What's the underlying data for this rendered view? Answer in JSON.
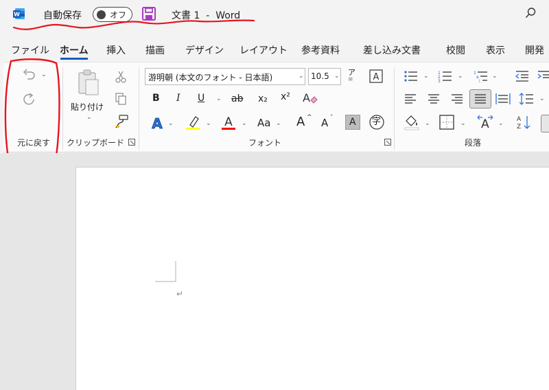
{
  "titlebar": {
    "autosave_label": "自動保存",
    "autosave_state": "オフ",
    "document_title": "文書 1  -  Word"
  },
  "tabs": [
    {
      "label": "ファイル",
      "active": false
    },
    {
      "label": "ホーム",
      "active": true
    },
    {
      "label": "挿入",
      "active": false
    },
    {
      "label": "描画",
      "active": false
    },
    {
      "label": "デザイン",
      "active": false
    },
    {
      "label": "レイアウト",
      "active": false
    },
    {
      "label": "参考資料",
      "active": false
    },
    {
      "label": "差し込み文書",
      "active": false
    },
    {
      "label": "校閲",
      "active": false
    },
    {
      "label": "表示",
      "active": false
    },
    {
      "label": "開発",
      "active": false
    }
  ],
  "ribbon": {
    "undo_group_label": "元に戻す",
    "clipboard_group_label": "クリップボード",
    "paste_label": "貼り付け",
    "font_group_label": "フォント",
    "paragraph_group_label": "段落",
    "font_name": "游明朝 (本文のフォント - 日本語)",
    "font_size": "10.5",
    "bold": "B",
    "italic": "I",
    "underline": "U",
    "strikethrough": "ab",
    "subscript": "x₂",
    "superscript": "x²",
    "font_color_letter": "A",
    "change_case": "Aa",
    "grow_font": "A",
    "shrink_font": "A",
    "char_shading": "A",
    "enclose_char": "字",
    "phonetic_letter": "ア"
  },
  "document": {
    "paragraph_mark": "↵"
  },
  "colors": {
    "word_blue": "#185abd",
    "save_purple": "#a73cc2",
    "highlight_yellow": "#ffff00",
    "font_red": "#ff0000",
    "annotation_red": "#e8141e"
  }
}
